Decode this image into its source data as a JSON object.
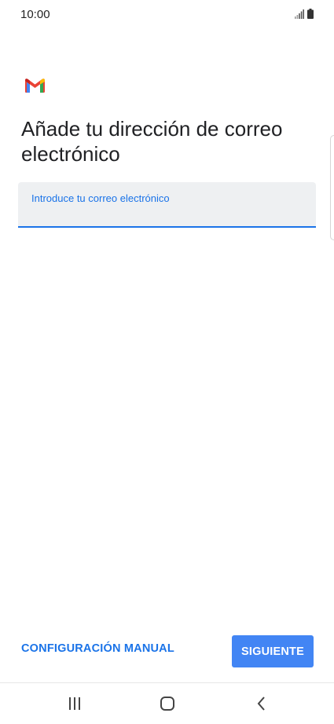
{
  "status_bar": {
    "time": "10:00",
    "signal_icon": "signal-icon",
    "battery_icon": "battery-icon"
  },
  "app": {
    "logo_icon": "gmail-logo-icon",
    "colors": {
      "gmail_blue": "#4285f4",
      "gmail_red": "#ea4335",
      "gmail_yellow": "#fbbc04",
      "gmail_green": "#34a853",
      "accent": "#1a73e8"
    }
  },
  "main": {
    "title": "Añade tu dirección de correo electrónico",
    "email_field": {
      "label": "Introduce tu correo electrónico",
      "value": ""
    }
  },
  "actions": {
    "manual_label": "CONFIGURACIÓN MANUAL",
    "next_label": "SIGUIENTE"
  },
  "nav_bar": {
    "recents_icon": "recents-icon",
    "home_icon": "home-icon",
    "back_icon": "back-icon"
  }
}
